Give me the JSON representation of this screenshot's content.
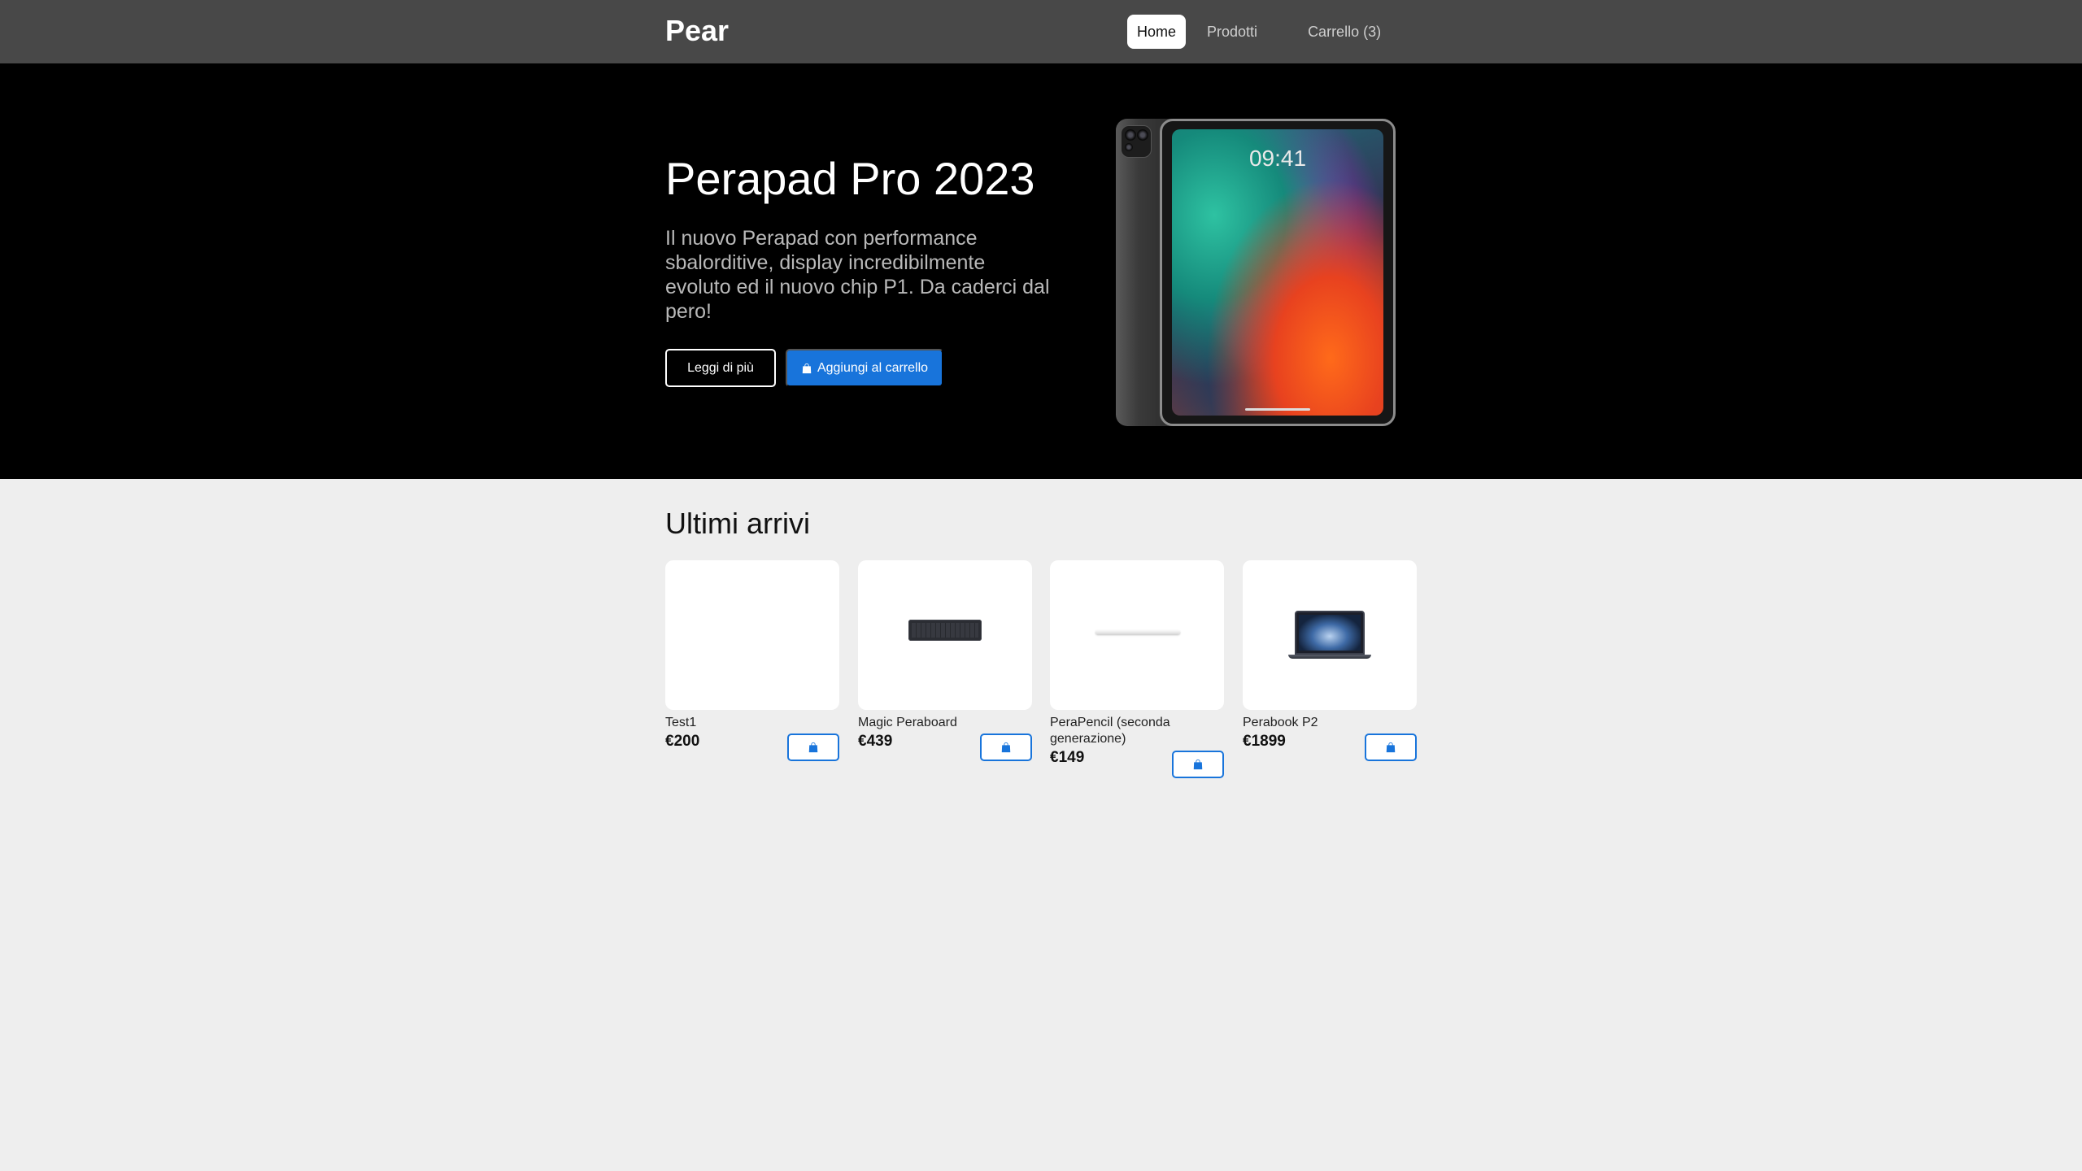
{
  "navbar": {
    "brand": "Pear",
    "links": [
      {
        "label": "Home",
        "active": true
      },
      {
        "label": "Prodotti",
        "active": false
      },
      {
        "label": "Carrello (3)",
        "active": false
      }
    ]
  },
  "hero": {
    "title": "Perapad Pro 2023",
    "description": "Il nuovo Perapad con performance sbalorditive, display incredibilmente evoluto ed il nuovo chip P1. Da caderci dal pero!",
    "read_more": "Leggi di più",
    "add_to_cart": "Aggiungi al carrello",
    "add_to_cart_icon": "bag-icon",
    "device_screen_time": "09:41"
  },
  "latest": {
    "title": "Ultimi arrivi",
    "products": [
      {
        "name": "Test1",
        "price": "€200",
        "image": "blank"
      },
      {
        "name": "Magic Peraboard",
        "price": "€439",
        "image": "keyboard"
      },
      {
        "name": "PeraPencil (seconda generazione)",
        "price": "€149",
        "image": "pencil"
      },
      {
        "name": "Perabook P2",
        "price": "€1899",
        "image": "laptop"
      }
    ]
  },
  "colors": {
    "navbar": "#484848",
    "hero_bg": "#000000",
    "accent": "#1874db",
    "page_bg": "#eeeeee"
  }
}
